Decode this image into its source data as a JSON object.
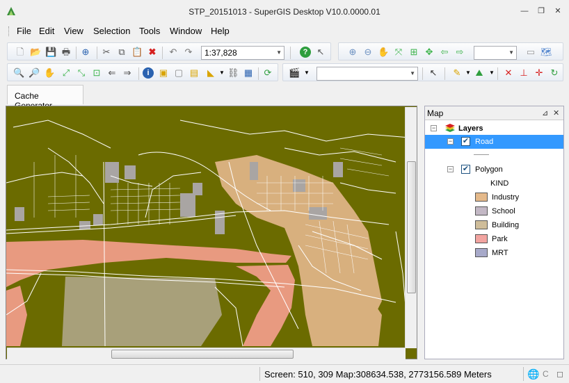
{
  "window": {
    "title": "STP_20151013 - SuperGIS Desktop V10.0.0000.01",
    "minimize": "—",
    "restore": "❐",
    "close": "✕"
  },
  "menu": [
    "File",
    "Edit",
    "View",
    "Selection",
    "Tools",
    "Window",
    "Help"
  ],
  "toolbar": {
    "scale": "1:37,828",
    "scale_placeholder": "",
    "layer_combo": "",
    "select_combo": ""
  },
  "tabs": [
    "Cache Generator"
  ],
  "map_panel": {
    "title": "Map",
    "pin": "📌",
    "close": "✕"
  },
  "toc": {
    "root": "Layers",
    "layers": [
      {
        "name": "Road",
        "checked": true,
        "selected": true
      },
      {
        "name": "Polygon",
        "checked": true,
        "selected": false
      }
    ],
    "field": "KIND",
    "legend": [
      {
        "label": "Industry",
        "color": "#e4b98a"
      },
      {
        "label": "School",
        "color": "#c3b8c5"
      },
      {
        "label": "Building",
        "color": "#cfbd9a"
      },
      {
        "label": "Park",
        "color": "#f2a4a0"
      },
      {
        "label": "MRT",
        "color": "#a7a9c9"
      }
    ]
  },
  "status": {
    "coords": "Screen: 510, 309  Map:308634.538, 2773156.589 Meters"
  },
  "colors": {
    "map_background": "#6b6b00",
    "road": "#ffffff",
    "industry": "#d8b07e",
    "building": "#a8a07a",
    "park": "#e89a80",
    "school": "#a9a5a3"
  }
}
